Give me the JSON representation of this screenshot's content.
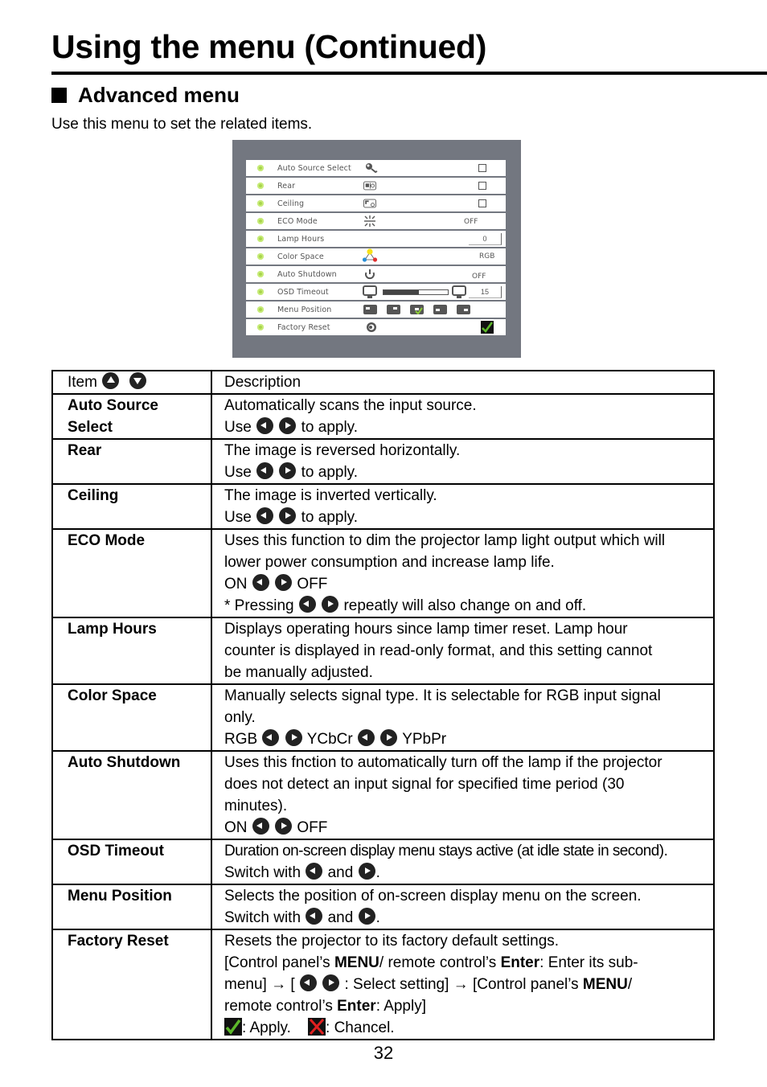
{
  "page": {
    "title": "Using the menu (Continued)",
    "section_heading": "Advanced menu",
    "intro": "Use this menu to set the related items.",
    "page_number": "32"
  },
  "osd": {
    "rows": [
      {
        "label": "Auto Source Select",
        "icon": "search-key-icon",
        "control": "checkbox",
        "checked": false
      },
      {
        "label": "Rear",
        "icon": "rear-projection-icon",
        "control": "checkbox",
        "checked": false
      },
      {
        "label": "Ceiling",
        "icon": "ceiling-projection-icon",
        "control": "checkbox",
        "checked": false
      },
      {
        "label": "ECO Mode",
        "icon": "eco-mode-icon",
        "control": "value",
        "value": "OFF"
      },
      {
        "label": "Lamp Hours",
        "icon": "",
        "control": "number",
        "value": "0"
      },
      {
        "label": "Color Space",
        "icon": "color-triangle-icon",
        "control": "value",
        "value": "RGB"
      },
      {
        "label": "Auto Shutdown",
        "icon": "power-icon",
        "control": "value",
        "value": "OFF"
      },
      {
        "label": "OSD Timeout",
        "icon": "monitor-icon",
        "control": "slider",
        "value": "15",
        "slider_fraction": 0.55
      },
      {
        "label": "Menu Position",
        "icon": "menu-position-icons",
        "control": "position",
        "selected_index": 2,
        "options_count": 5
      },
      {
        "label": "Factory Reset",
        "icon": "reset-icon",
        "control": "apply",
        "value": "check"
      }
    ]
  },
  "table": {
    "header": {
      "item": "Item",
      "description": "Description"
    },
    "common": {
      "use": "Use",
      "to_apply": "to apply.",
      "on": "ON",
      "off": "OFF",
      "switch_with": "Switch with",
      "and": "and",
      "period": "."
    },
    "rows": [
      {
        "item": "Auto Source Select",
        "lines": [
          "Automatically scans the input source."
        ]
      },
      {
        "item": "Rear",
        "lines": [
          "The image is reversed horizontally."
        ]
      },
      {
        "item": "Ceiling",
        "lines": [
          "The image is inverted vertically."
        ]
      },
      {
        "item": "ECO Mode",
        "lines": [
          "Uses this function to dim the projector lamp light output which will",
          "lower power consumption and increase lamp life."
        ],
        "note_prefix": "* Pressing",
        "note_suffix": "repeatly will also change on and off."
      },
      {
        "item": "Lamp Hours",
        "lines": [
          "Displays operating hours since lamp timer reset. Lamp hour",
          "counter is displayed in read-only format, and this setting cannot",
          "be manually adjusted."
        ]
      },
      {
        "item": "Color Space",
        "lines": [
          "Manually selects signal type. It is selectable for RGB input signal",
          "only."
        ],
        "options": [
          "RGB",
          "YCbCr",
          "YPbPr"
        ]
      },
      {
        "item": "Auto Shutdown",
        "lines": [
          "Uses this fnction to automatically turn off the lamp if the projector",
          "does not detect an input signal for specified time period (30",
          "minutes)."
        ]
      },
      {
        "item": "OSD Timeout",
        "lines": [
          "Duration on-screen display menu stays active (at idle state in second)."
        ]
      },
      {
        "item": "Menu Position",
        "lines": [
          "Selects the position of on-screen display menu on the screen."
        ]
      },
      {
        "item": "Factory Reset",
        "lines": [
          "Resets the projector to its factory default settings."
        ],
        "seq": {
          "p1": "[Control panel’s ",
          "b1": "MENU",
          "p2": "/ remote control’s ",
          "b2": "Enter",
          "p3": ": Enter its sub-",
          "p4": "menu] → [ ",
          "p5": " : Select setting] → [Control panel’s ",
          "b3": "MENU",
          "p6": "/",
          "p7": "remote control’s ",
          "b4": "Enter",
          "p8": ": Apply]"
        },
        "apply_label": ": Apply.",
        "cancel_label": ": Chancel."
      }
    ]
  }
}
